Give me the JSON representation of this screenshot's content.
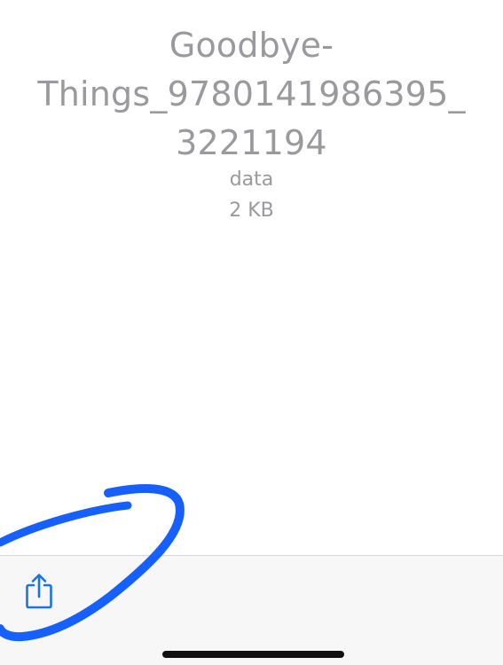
{
  "file": {
    "name_lines": [
      "Goodbye-",
      "Things_9780141986395_",
      "3221194"
    ],
    "kind": "data",
    "size": "2 KB"
  },
  "toolbar": {
    "share_icon": "share-icon"
  },
  "colors": {
    "text_secondary": "#9a9a9e",
    "accent": "#1a73e8",
    "toolbar_bg": "#f7f7f8",
    "annotation": "#1560ff"
  }
}
